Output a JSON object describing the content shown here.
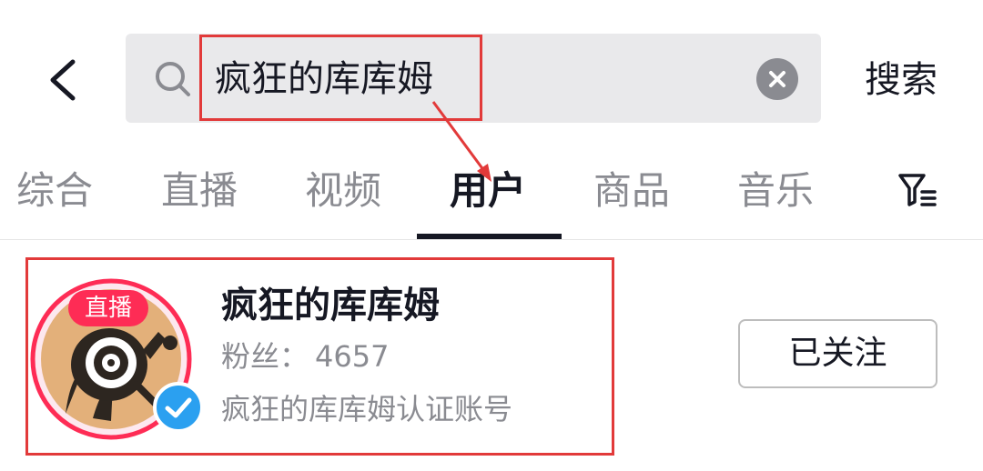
{
  "header": {
    "search_query": "疯狂的库库姆",
    "search_button_label": "搜索"
  },
  "tabs": [
    {
      "label": "综合"
    },
    {
      "label": "直播"
    },
    {
      "label": "视频"
    },
    {
      "label": "用户",
      "active": true
    },
    {
      "label": "商品"
    },
    {
      "label": "音乐"
    }
  ],
  "result": {
    "live_badge": "直播",
    "name": "疯狂的库库姆",
    "fans_label": "粉丝：",
    "fans_count": "4657",
    "verify_text": "疯狂的库库姆认证账号",
    "follow_label": "已关注"
  },
  "colors": {
    "accent_live": "#fe2c55",
    "verified_badge": "#2ba0f0",
    "annotation": "#e23a3a"
  },
  "icons": [
    "back-arrow-icon",
    "search-icon",
    "clear-icon",
    "filter-icon",
    "verified-check-icon"
  ]
}
